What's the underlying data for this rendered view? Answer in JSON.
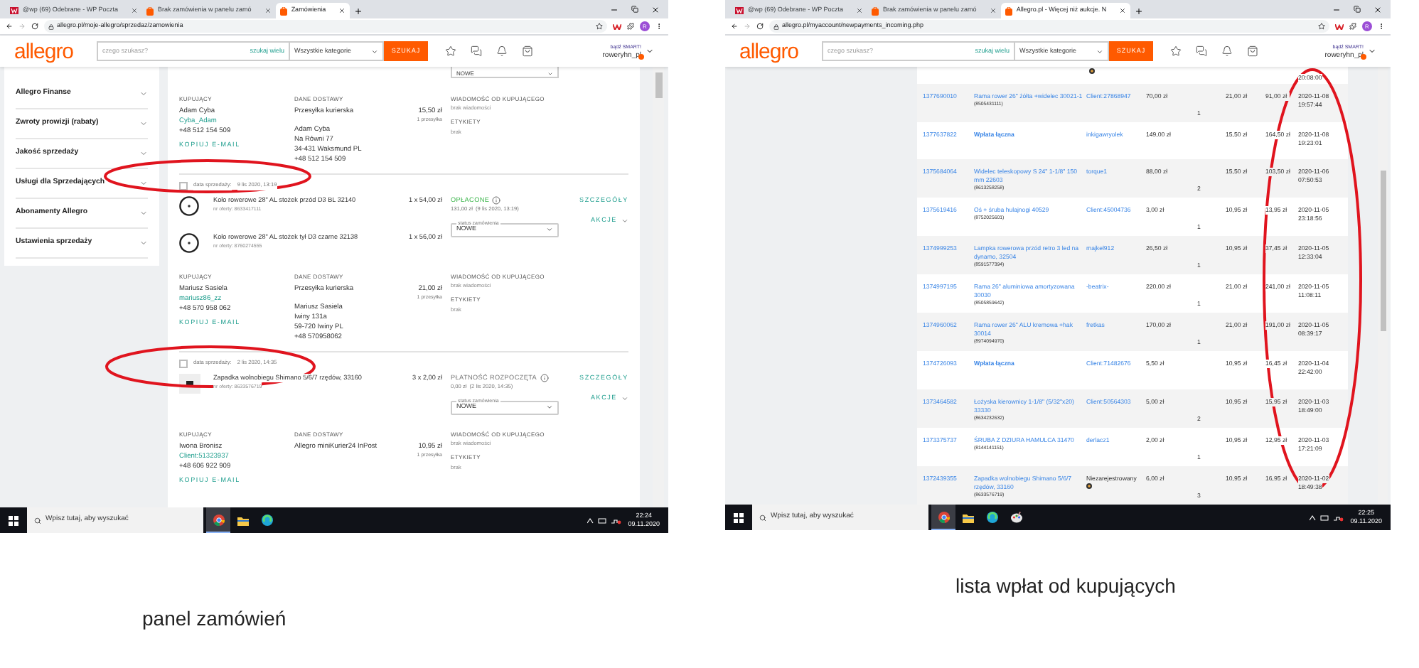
{
  "left_screen": {
    "tabs": [
      {
        "label": "@wp (69) Odebrane - WP Poczta",
        "kind": "mail",
        "selected": false
      },
      {
        "label": "Brak zamówienia w panelu zamó",
        "kind": "shop",
        "selected": false
      },
      {
        "label": "Zamówienia",
        "kind": "shop",
        "selected": true
      }
    ],
    "url": "allegro.pl/moje-allegro/sprzedaz/zamowienia",
    "avatar_letter": "R",
    "header": {
      "logo": "allegro",
      "search_placeholder": "czego szukasz?",
      "search_many": "szukaj wielu",
      "category": "Wszystkie kategorie",
      "search_button": "SZUKAJ",
      "smart": "bądź SMART!",
      "user": "roweryhn_pl"
    },
    "sidebar": [
      {
        "label": "Allegro Finanse",
        "expanded": false
      },
      {
        "label": "Zwroty prowizji (rabaty)",
        "expanded": false
      },
      {
        "label": "Jakość sprzedaży",
        "expanded": false
      },
      {
        "label": "Usługi dla Sprzedających",
        "expanded": false
      },
      {
        "label": "Abonamenty Allegro",
        "expanded": false
      },
      {
        "label": "Ustawienia sprzedaży",
        "expanded": false
      }
    ],
    "top_status": "NOWE",
    "orders": [
      {
        "buyer": {
          "heading": "KUPUJĄCY",
          "name": "Adam Cyba",
          "login": "Cyba_Adam",
          "phone": "+48 512 154 509",
          "copy": "KOPIUJ E-MAIL"
        },
        "delivery": {
          "heading": "DANE DOSTAWY",
          "method": "Przesyłka kurierska",
          "price": "15,50 zł",
          "count": "1 przesyłka",
          "address": [
            "Adam Cyba",
            "Na Równi 77",
            "34-431 Waksmund PL",
            "+48 512 154 509"
          ]
        },
        "message": {
          "heading": "WIADOMOŚĆ OD KUPUJĄCEGO",
          "text": "brak wiadomości",
          "labels_heading": "ETYKIETY",
          "labels": "brak"
        }
      },
      {
        "checked": false,
        "date_label": "data sprzedaży:",
        "date": "9 lis 2020, 13:19",
        "items": [
          {
            "kind": "wheel",
            "title": "Koło rowerowe 28\" AL stożek przód D3 BL 32140",
            "offer": "nr oferty: 8633417111",
            "qty_price": "1 x 54,00 zł"
          },
          {
            "kind": "wheel",
            "title": "Koło rowerowe 28\" AL stożek tył D3 czarne 32138",
            "offer": "nr oferty: 8760274555",
            "qty_price": "1 x 56,00 zł"
          }
        ],
        "payment": {
          "kind": "paid",
          "status": "OPŁACONE",
          "detail": "131,00 zł  (9 lis 2020, 13:19)"
        },
        "status_label": "status zamówienia",
        "status_value": "NOWE",
        "details": "SZCZEGÓŁY",
        "actions": "AKCJE",
        "buyer": {
          "heading": "KUPUJĄCY",
          "name": "Mariusz Sasiela",
          "login": "mariusz86_zz",
          "phone": "+48 570 958 062",
          "copy": "KOPIUJ E-MAIL"
        },
        "delivery": {
          "heading": "DANE DOSTAWY",
          "method": "Przesyłka kurierska",
          "price": "21,00 zł",
          "count": "1 przesyłka",
          "address": [
            "Mariusz Sasiela",
            "Iwiny 131a",
            "59-720 Iwiny PL",
            "+48 570958062"
          ]
        },
        "message": {
          "heading": "WIADOMOŚĆ OD KUPUJĄCEGO",
          "text": "brak wiadomości",
          "labels_heading": "ETYKIETY",
          "labels": "brak"
        }
      },
      {
        "checked": false,
        "date_label": "data sprzedaży:",
        "date": "2 lis 2020, 14:35",
        "items": [
          {
            "kind": "part",
            "title": "Zapadka wolnobiegu Shimano 5/6/7 rzędów, 33160",
            "offer": "nr oferty: 8633576719",
            "qty_price": "3 x 2,00 zł"
          }
        ],
        "payment": {
          "kind": "started",
          "status": "PŁATNOŚĆ ROZPOCZĘTA",
          "detail": "0,00 zł  (2 lis 2020, 14:35)"
        },
        "status_label": "status zamówienia",
        "status_value": "NOWE",
        "details": "SZCZEGÓŁY",
        "actions": "AKCJE",
        "buyer": {
          "heading": "KUPUJĄCY",
          "name": "Iwona Bronisz",
          "login": "Client:51323937",
          "phone": "+48 606 922 909",
          "copy": "KOPIUJ E-MAIL"
        },
        "delivery": {
          "heading": "DANE DOSTAWY",
          "method": "Allegro miniKurier24 InPost",
          "price": "10,95 zł",
          "count": "1 przesyłka"
        },
        "message": {
          "heading": "WIADOMOŚĆ OD KUPUJĄCEGO",
          "text": "brak wiadomości",
          "labels_heading": "ETYKIETY",
          "labels": "brak"
        }
      }
    ],
    "taskbar": {
      "search_placeholder": "Wpisz tutaj, aby wyszukać",
      "apps": [
        {
          "kind": "browser",
          "selected": true
        },
        {
          "kind": "folder",
          "selected": false
        },
        {
          "kind": "swirl",
          "selected": false
        }
      ],
      "time": "22:24",
      "date": "09.11.2020"
    },
    "caption": "panel zamówień"
  },
  "right_screen": {
    "tabs": [
      {
        "label": "@wp (69) Odebrane - WP Poczta",
        "kind": "mail",
        "selected": false
      },
      {
        "label": "Brak zamówienia w panelu zamó",
        "kind": "shop",
        "selected": false
      },
      {
        "label": "Allegro.pl - Więcej niż aukcje. N",
        "kind": "shop",
        "selected": true
      }
    ],
    "url": "allegro.pl/myaccount/newpayments_incoming.php",
    "avatar_letter": "R",
    "header": {
      "logo": "allegro",
      "search_placeholder": "czego szukasz?",
      "search_many": "szukaj wielu",
      "category": "Wszystkie kategorie",
      "search_button": "SZUKAJ",
      "smart": "bądź SMART!",
      "user": "roweryhn_pl"
    },
    "top_row_time": "20:08:00",
    "payments": [
      {
        "id": "1377690010",
        "title": "Rama rower 26\" żółta +widelec 30021-1",
        "code": "(8505431111)",
        "buyer": "Client:27868947",
        "registered": true,
        "price": "70,00 zł",
        "qty": "1",
        "shipping": "21,00 zł",
        "total": "91,00 zł",
        "date": "2020-11-08",
        "time": "19:57:44"
      },
      {
        "id": "1377637822",
        "title": "Wpłata łączna",
        "buyer": "inkigawryolek",
        "registered": true,
        "price": "149,00 zł",
        "shipping": "15,50 zł",
        "total": "164,50 zł",
        "date": "2020-11-08",
        "time": "19:23:01"
      },
      {
        "id": "1375684064",
        "title": "Widelec teleskopowy S 24\" 1-1/8\" 150 mm 22603",
        "code": "(8613258258)",
        "buyer": "torque1",
        "registered": true,
        "price": "88,00 zł",
        "qty": "2",
        "shipping": "15,50 zł",
        "total": "103,50 zł",
        "date": "2020-11-06",
        "time": "07:50:53"
      },
      {
        "id": "1375619416",
        "title": "Oś + śruba hulajnogi 40529",
        "code": "(8752025601)",
        "buyer": "Client:45004736",
        "registered": true,
        "price": "3,00 zł",
        "qty": "1",
        "shipping": "10,95 zł",
        "total": "13,95 zł",
        "date": "2020-11-05",
        "time": "23:18:56"
      },
      {
        "id": "1374999253",
        "title": "Lampka rowerowa przód retro 3 led na dynamo, 32504",
        "code": "(8591577394)",
        "buyer": "majkel912",
        "registered": true,
        "price": "26,50 zł",
        "qty": "1",
        "shipping": "10,95 zł",
        "total": "37,45 zł",
        "date": "2020-11-05",
        "time": "12:33:04"
      },
      {
        "id": "1374997195",
        "title": "Rama 26\" aluminiowa amortyzowana 30030",
        "code": "(8505859642)",
        "buyer": "-beatrix-",
        "registered": true,
        "price": "220,00 zł",
        "qty": "1",
        "shipping": "21,00 zł",
        "total": "241,00 zł",
        "date": "2020-11-05",
        "time": "11:08:11"
      },
      {
        "id": "1374960062",
        "title": "Rama rower 26\" ALU kremowa +hak 30014",
        "code": "(8974094970)",
        "buyer": "fretkas",
        "registered": true,
        "price": "170,00 zł",
        "qty": "1",
        "shipping": "21,00 zł",
        "total": "191,00 zł",
        "date": "2020-11-05",
        "time": "08:39:17"
      },
      {
        "id": "1374726093",
        "title": "Wpłata łączna",
        "buyer": "Client:71482676",
        "registered": true,
        "price": "5,50 zł",
        "shipping": "10,95 zł",
        "total": "16,45 zł",
        "date": "2020-11-04",
        "time": "22:42:00"
      },
      {
        "id": "1373464582",
        "title": "Łożyska kierownicy 1-1/8\" (5/32\"x20) 33330",
        "code": "(8634232632)",
        "buyer": "Client:50564303",
        "registered": true,
        "price": "5,00 zł",
        "qty": "2",
        "shipping": "10,95 zł",
        "total": "15,95 zł",
        "date": "2020-11-03",
        "time": "18:49:00"
      },
      {
        "id": "1373375737",
        "title": "ŚRUBA Z DZIURA HAMULCA 31470",
        "code": "(8144141151)",
        "buyer": "derlacz1",
        "registered": true,
        "price": "2,00 zł",
        "qty": "1",
        "shipping": "10,95 zł",
        "total": "12,95 zł",
        "date": "2020-11-03",
        "time": "17:21:09"
      },
      {
        "id": "1372439355",
        "title": "Zapadka wolnobiegu Shimano 5/6/7 rzędów, 33160",
        "code": "(8633576719)",
        "buyer": "Niezarejestrowany",
        "registered": false,
        "price": "6,00 zł",
        "qty": "3",
        "shipping": "10,95 zł",
        "total": "16,95 zł",
        "date": "2020-11-02",
        "time": "18:49:38"
      }
    ],
    "taskbar": {
      "search_placeholder": "Wpisz tutaj, aby wyszukać",
      "apps": [
        {
          "kind": "browser",
          "selected": true
        },
        {
          "kind": "folder",
          "selected": false
        },
        {
          "kind": "swirl",
          "selected": false
        },
        {
          "kind": "palette",
          "selected": false
        }
      ],
      "time": "22:25",
      "date": "09.11.2020"
    },
    "caption": "lista wpłat od kupujących"
  }
}
